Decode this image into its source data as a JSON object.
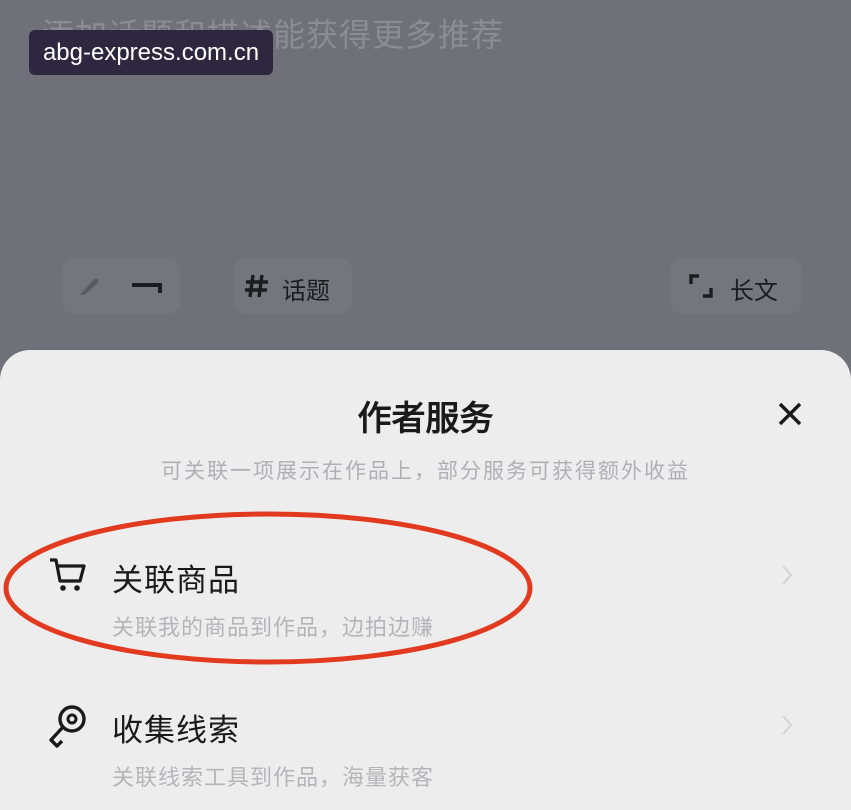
{
  "editor": {
    "placeholder": "添加话题和描述能获得更多推荐"
  },
  "watermark": "abg-express.com.cn",
  "toolbar": {
    "hashtag_label": "话题",
    "longtext_label": "长文"
  },
  "sheet": {
    "title": "作者服务",
    "subtitle": "可关联一项展示在作品上，部分服务可获得额外收益",
    "items": [
      {
        "icon": "cart-icon",
        "title": "关联商品",
        "desc": "关联我的商品到作品，边拍边赚",
        "highlighted": true
      },
      {
        "icon": "key-icon",
        "title": "收集线索",
        "desc": "关联线索工具到作品，海量获客",
        "highlighted": false
      }
    ]
  },
  "colors": {
    "overlay": "#707078",
    "sheet_bg": "#eeeded",
    "highlight_ring": "#e23a1e"
  }
}
